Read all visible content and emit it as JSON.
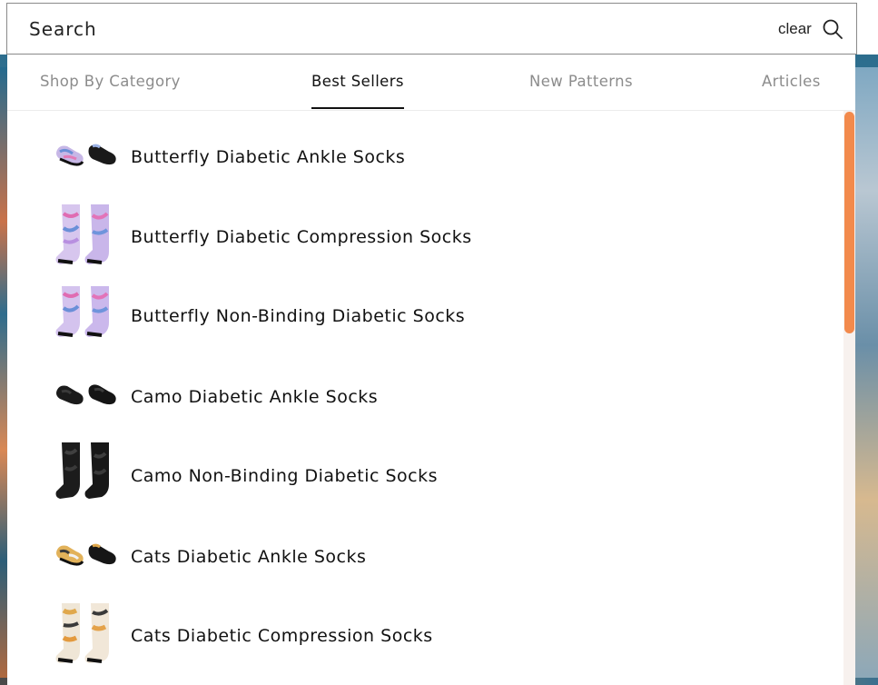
{
  "search": {
    "placeholder": "Search",
    "clear_label": "clear",
    "icon": "search-icon"
  },
  "tabs": [
    {
      "label": "Shop By Category",
      "active": false
    },
    {
      "label": "Best Sellers",
      "active": true
    },
    {
      "label": "New Patterns",
      "active": false
    },
    {
      "label": "Articles",
      "active": false
    }
  ],
  "results": [
    {
      "label": "Butterfly Diabetic Ankle Socks",
      "thumb": "ankle-socks-butterfly-icon"
    },
    {
      "label": "Butterfly Diabetic Compression Socks",
      "thumb": "compression-socks-butterfly-icon"
    },
    {
      "label": "Butterfly Non-Binding Diabetic Socks",
      "thumb": "crew-socks-butterfly-icon"
    },
    {
      "label": "Camo Diabetic Ankle Socks",
      "thumb": "ankle-socks-camo-icon"
    },
    {
      "label": "Camo Non-Binding Diabetic Socks",
      "thumb": "crew-socks-camo-icon"
    },
    {
      "label": "Cats Diabetic Ankle Socks",
      "thumb": "ankle-socks-cats-icon"
    },
    {
      "label": "Cats Diabetic Compression Socks",
      "thumb": "compression-socks-cats-icon"
    }
  ],
  "colors": {
    "accent": "#f28a4c",
    "active_tab": "#111111",
    "inactive_tab": "#8c8c8c"
  }
}
